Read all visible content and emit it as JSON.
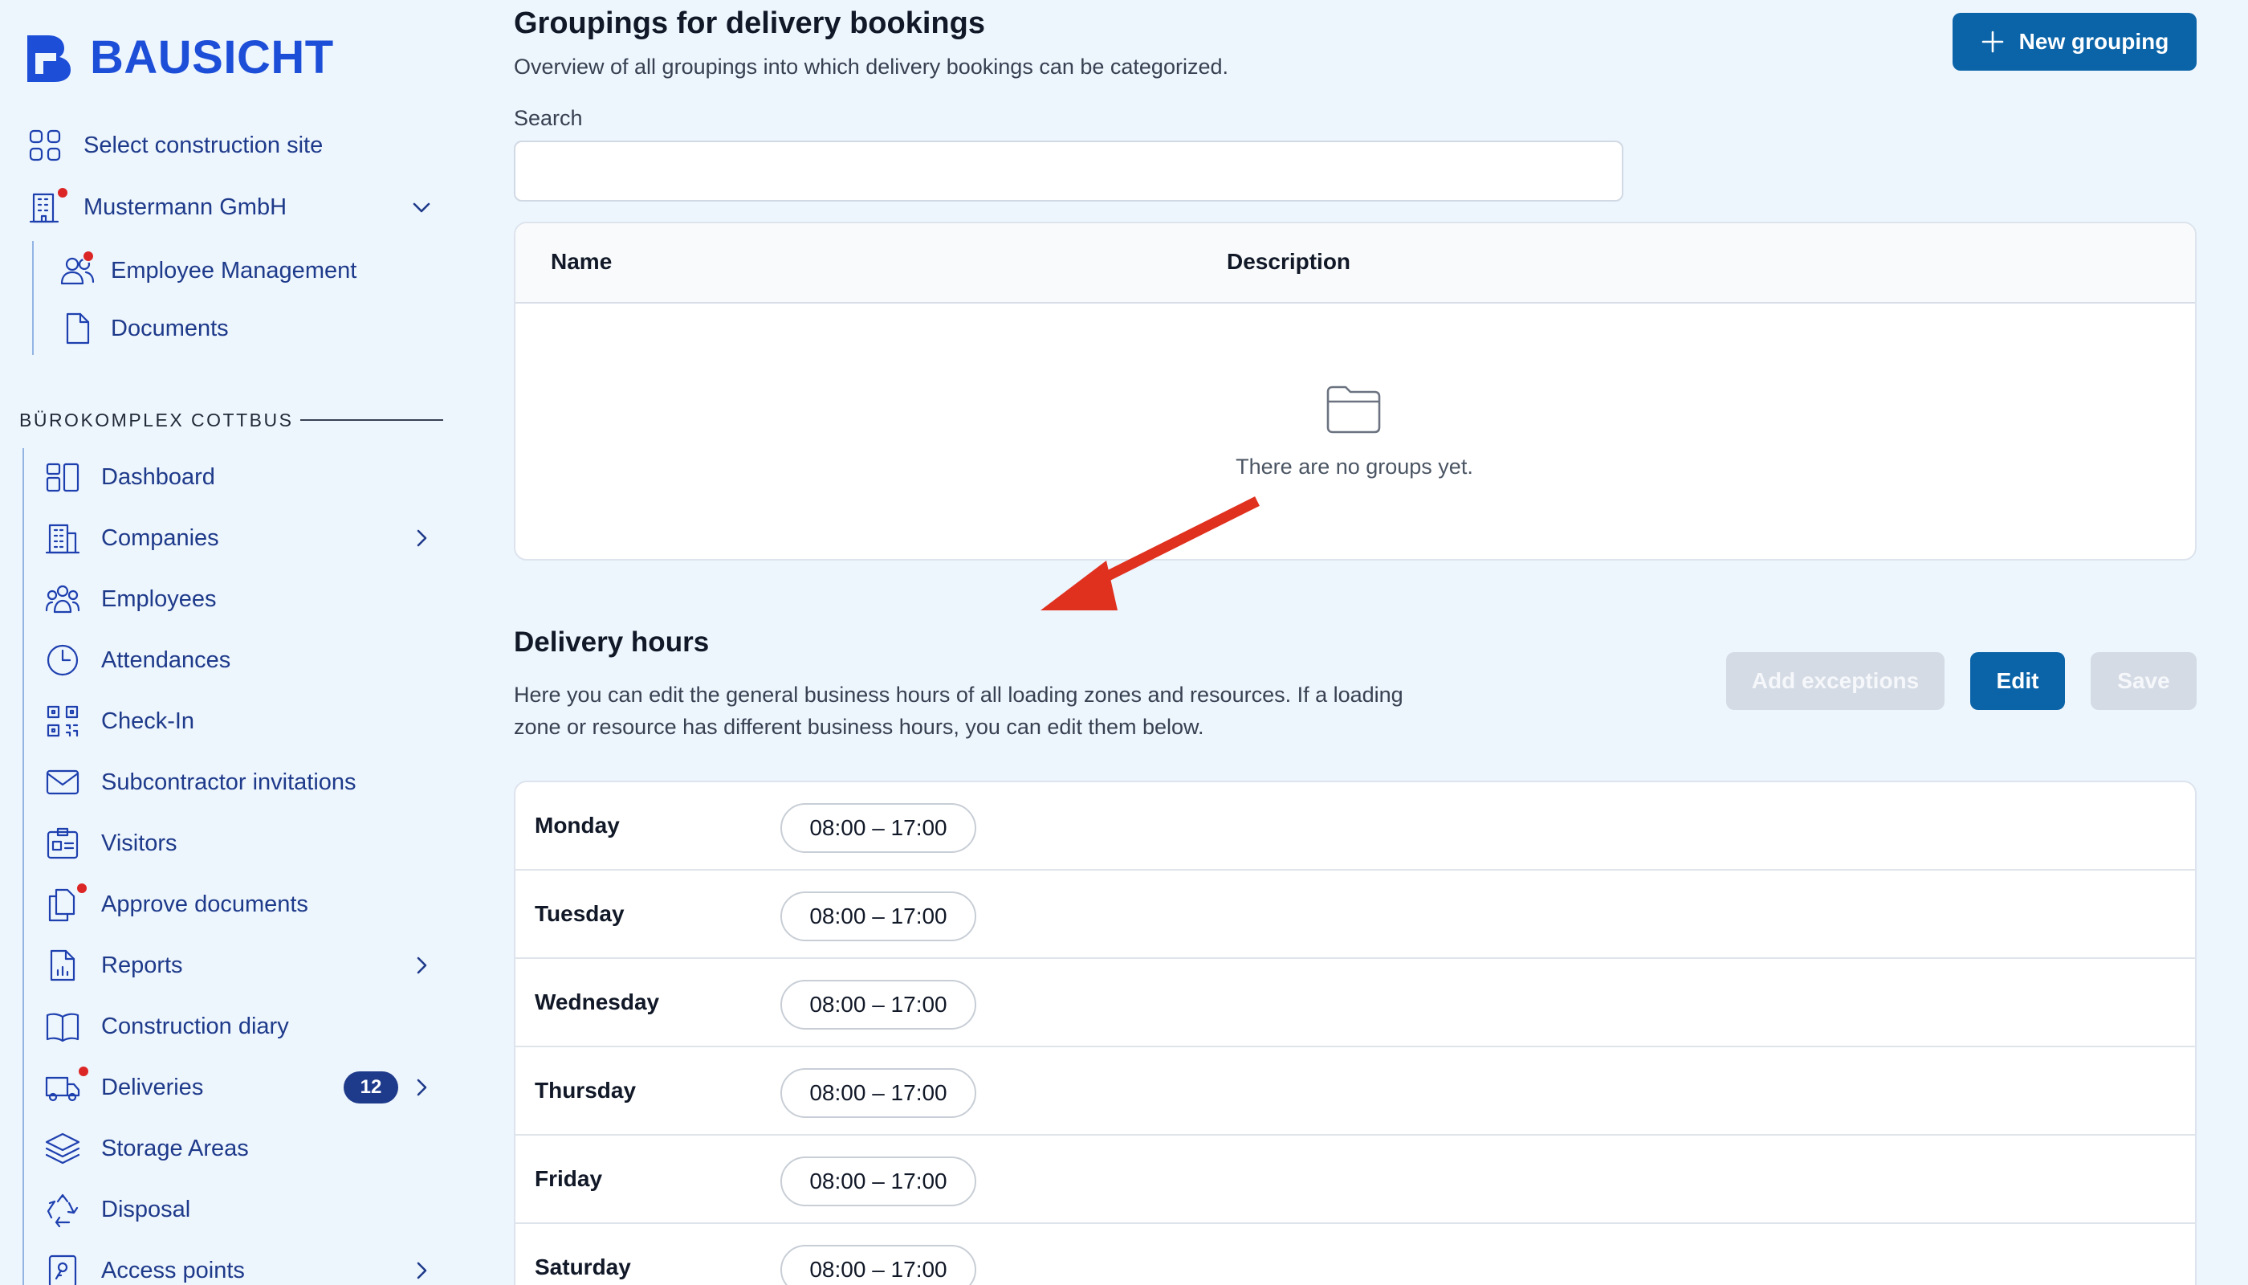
{
  "brand": {
    "name": "BAUSICHT",
    "accent": "#1d4ed8"
  },
  "top_nav": {
    "select_site": {
      "label": "Select construction site",
      "icon": "grid-icon"
    },
    "company": {
      "label": "Mustermann GmbH",
      "icon": "building-icon",
      "expanded": true
    },
    "company_children": [
      {
        "label": "Employee Management",
        "icon": "users-icon"
      },
      {
        "label": "Documents",
        "icon": "document-icon"
      }
    ]
  },
  "site": {
    "title": "BÜROKOMPLEX COTTBUS",
    "items": [
      {
        "label": "Dashboard",
        "icon": "dashboard-icon"
      },
      {
        "label": "Companies",
        "icon": "building-icon"
      },
      {
        "label": "Employees",
        "icon": "users-icon"
      },
      {
        "label": "Attendances",
        "icon": "clock-icon"
      },
      {
        "label": "Check-In",
        "icon": "qr-code-icon"
      },
      {
        "label": "Subcontractor invitations",
        "icon": "mail-icon"
      },
      {
        "label": "Visitors",
        "icon": "id-card-icon"
      },
      {
        "label": "Approve documents",
        "icon": "documents-icon"
      },
      {
        "label": "Reports",
        "icon": "report-icon"
      },
      {
        "label": "Construction diary",
        "icon": "book-icon"
      },
      {
        "label": "Deliveries",
        "icon": "truck-icon",
        "badge": "12"
      },
      {
        "label": "Storage Areas",
        "icon": "layers-icon"
      },
      {
        "label": "Disposal",
        "icon": "recycle-icon"
      },
      {
        "label": "Access points",
        "icon": "key-card-icon"
      }
    ]
  },
  "groupings": {
    "title": "Groupings for delivery bookings",
    "subtitle": "Overview of all groupings into which delivery bookings can be categorized.",
    "new_button": "New grouping",
    "search_label": "Search",
    "search_value": "",
    "columns": [
      "Name",
      "Description"
    ],
    "empty_text": "There are no groups yet."
  },
  "delivery_hours": {
    "title": "Delivery hours",
    "description": "Here you can edit the general business hours of all loading zones and resources. If a loading zone or resource has different business hours, you can edit them below.",
    "buttons": {
      "exceptions": "Add exceptions",
      "edit": "Edit",
      "save": "Save"
    },
    "days": [
      {
        "day": "Monday",
        "hours": "08:00 – 17:00"
      },
      {
        "day": "Tuesday",
        "hours": "08:00 – 17:00"
      },
      {
        "day": "Wednesday",
        "hours": "08:00 – 17:00"
      },
      {
        "day": "Thursday",
        "hours": "08:00 – 17:00"
      },
      {
        "day": "Friday",
        "hours": "08:00 – 17:00"
      },
      {
        "day": "Saturday",
        "hours": "08:00 – 17:00"
      }
    ]
  },
  "colors": {
    "primary": "#0b64a8",
    "notification": "#dc2626",
    "annotation_arrow": "#e0301e"
  }
}
